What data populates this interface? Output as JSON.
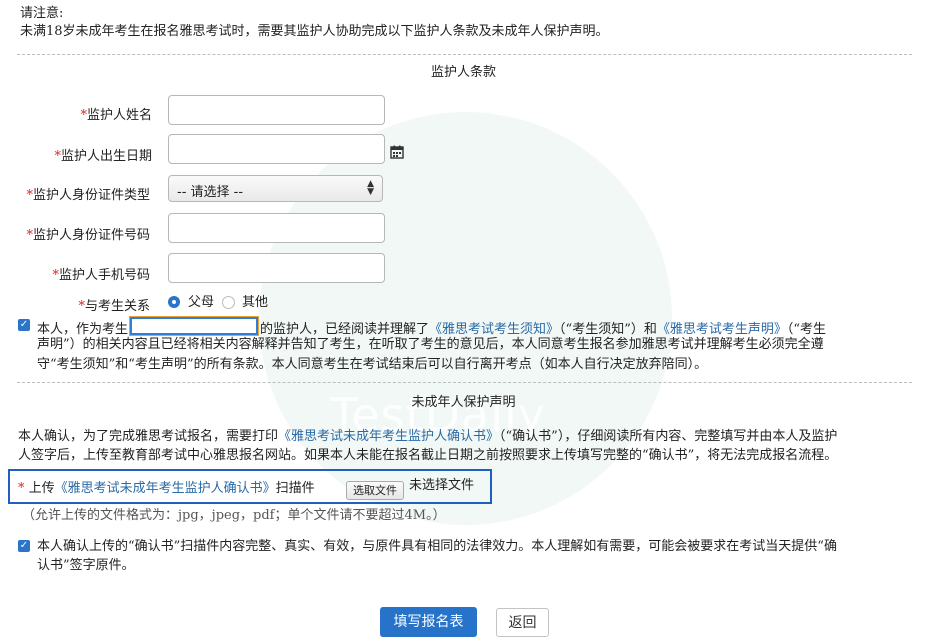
{
  "notice": {
    "heading": "请注意:",
    "text": "未满18岁未成年考生在报名雅思考试时，需要其监护人协助完成以下监护人条款及未成年人保护声明。"
  },
  "guardian_section": {
    "title": "监护人条款",
    "fields": {
      "name_label": "监护人姓名",
      "dob_label": "监护人出生日期",
      "id_type_label": "监护人身份证件类型",
      "id_type_value": "-- 请选择 --",
      "id_number_label": "监护人身份证件号码",
      "phone_label": "监护人手机号码",
      "relation_label": "与考生关系",
      "relation_option_parent": "父母",
      "relation_option_other": "其他"
    },
    "declaration": {
      "part1": "本人，作为考生",
      "part2": "的监护人，已经阅读并理解了",
      "link1": "《雅思考试考生须知》",
      "part3": "（“考生须知”）和",
      "link2": "《雅思考试考生声明》",
      "part4": "（“考生",
      "line2": "声明”）的相关内容且已经将相关内容解释并告知了考生，在听取了考生的意见后，本人同意考生报名参加雅思考试并理解考生必须完全遵",
      "line3": "守“考生须知”和“考生声明”的所有条款。本人同意考生在考试结束后可以自行离开考点（如本人自行决定放弃陪同）。"
    }
  },
  "minor_section": {
    "title": "未成年人保护声明",
    "para_part1": "本人确认，为了完成雅思考试报名，需要打印",
    "para_link": "《雅思考试未成年考生监护人确认书》",
    "para_part2": "（“确认书”），仔细阅读所有内容、完整填写并由本人及监护",
    "para_line2": "人签字后，上传至教育部考试中心雅思报名网站。如果本人未能在报名截止日期之前按照要求上传填写完整的“确认书”，将无法完成报名流程。",
    "upload_prefix": "上传",
    "upload_link": "《雅思考试未成年考生监护人确认书》",
    "upload_suffix": "扫描件",
    "choose_file_button": "选取文件",
    "no_file_text": "未选择文件",
    "format_note": "（允许上传的文件格式为：jpg，jpeg，pdf；单个文件请不要超过4M。）",
    "confirm_line1": "本人确认上传的“确认书”扫描件内容完整、真实、有效，与原件具有相同的法律效力。本人理解如有需要，可能会被要求在考试当天提供“确",
    "confirm_line2": "认书”签字原件。"
  },
  "buttons": {
    "submit": "填写报名表",
    "back": "返回"
  },
  "watermark": "TestDaily",
  "colors": {
    "accent": "#2673c9",
    "required": "#e0261b",
    "link": "#2a6aa6",
    "highlight_border": "#1f5fbf",
    "input_focus_border": "#f0a030"
  }
}
